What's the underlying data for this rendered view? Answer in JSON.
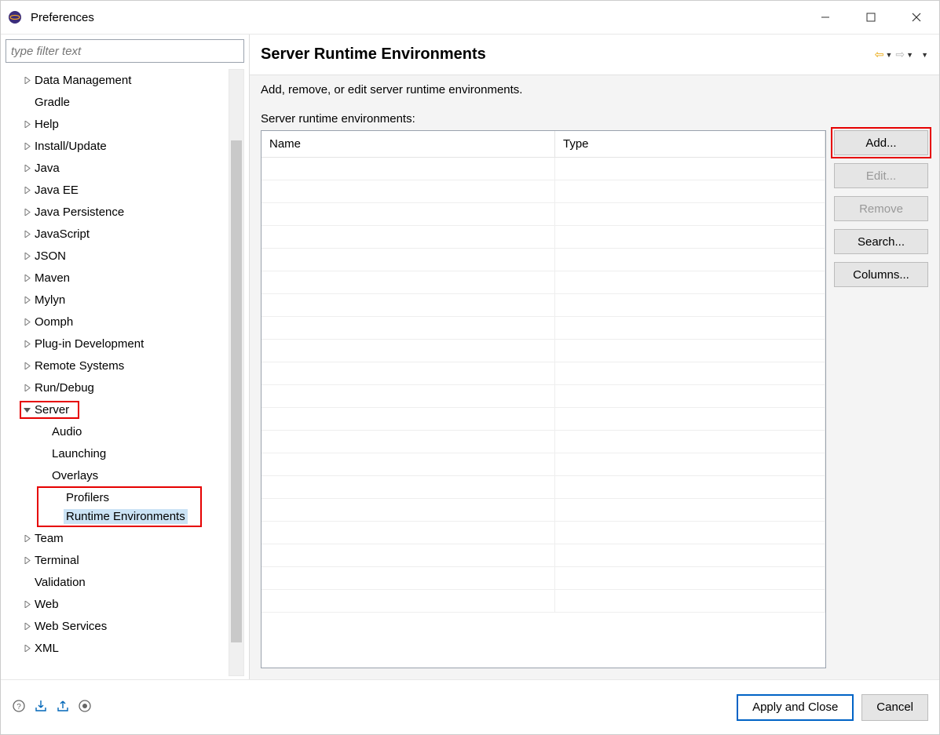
{
  "window": {
    "title": "Preferences"
  },
  "filter": {
    "placeholder": "type filter text"
  },
  "tree": [
    {
      "label": "Data Management",
      "expandable": true,
      "level": 1
    },
    {
      "label": "Gradle",
      "expandable": false,
      "level": 1
    },
    {
      "label": "Help",
      "expandable": true,
      "level": 1
    },
    {
      "label": "Install/Update",
      "expandable": true,
      "level": 1
    },
    {
      "label": "Java",
      "expandable": true,
      "level": 1
    },
    {
      "label": "Java EE",
      "expandable": true,
      "level": 1
    },
    {
      "label": "Java Persistence",
      "expandable": true,
      "level": 1
    },
    {
      "label": "JavaScript",
      "expandable": true,
      "level": 1
    },
    {
      "label": "JSON",
      "expandable": true,
      "level": 1
    },
    {
      "label": "Maven",
      "expandable": true,
      "level": 1
    },
    {
      "label": "Mylyn",
      "expandable": true,
      "level": 1
    },
    {
      "label": "Oomph",
      "expandable": true,
      "level": 1
    },
    {
      "label": "Plug-in Development",
      "expandable": true,
      "level": 1
    },
    {
      "label": "Remote Systems",
      "expandable": true,
      "level": 1
    },
    {
      "label": "Run/Debug",
      "expandable": true,
      "level": 1
    },
    {
      "label": "Server",
      "expandable": true,
      "expanded": true,
      "level": 1,
      "highlight": true
    },
    {
      "label": "Audio",
      "expandable": false,
      "level": 2
    },
    {
      "label": "Launching",
      "expandable": false,
      "level": 2
    },
    {
      "label": "Overlays",
      "expandable": false,
      "level": 2
    },
    {
      "label": "Profilers",
      "expandable": false,
      "level": 2,
      "in_rt_box": true
    },
    {
      "label": "Runtime Environments",
      "expandable": false,
      "level": 2,
      "selected": true,
      "in_rt_box": true
    },
    {
      "label": "Team",
      "expandable": true,
      "level": 1
    },
    {
      "label": "Terminal",
      "expandable": true,
      "level": 1
    },
    {
      "label": "Validation",
      "expandable": false,
      "level": 1
    },
    {
      "label": "Web",
      "expandable": true,
      "level": 1
    },
    {
      "label": "Web Services",
      "expandable": true,
      "level": 1
    },
    {
      "label": "XML",
      "expandable": true,
      "level": 1
    }
  ],
  "content": {
    "title": "Server Runtime Environments",
    "description": "Add, remove, or edit server runtime environments.",
    "list_label": "Server runtime environments:",
    "columns": {
      "name": "Name",
      "type": "Type"
    },
    "buttons": {
      "add": "Add...",
      "edit": "Edit...",
      "remove": "Remove",
      "search": "Search...",
      "columns": "Columns..."
    }
  },
  "footer": {
    "apply_close": "Apply and Close",
    "cancel": "Cancel"
  }
}
